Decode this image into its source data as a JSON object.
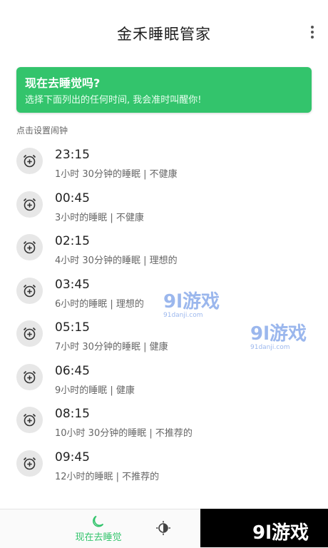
{
  "app": {
    "title": "金禾睡眠管家"
  },
  "banner": {
    "title": "现在去睡觉吗?",
    "subtitle": "选择下面列出的任何时间, 我会准时叫醒你!"
  },
  "section_label": "点击设置闹钟",
  "alarms": [
    {
      "time": "23:15",
      "desc": "1小时 30分钟的睡眠 | 不健康"
    },
    {
      "time": "00:45",
      "desc": "3小时的睡眠 | 不健康"
    },
    {
      "time": "02:15",
      "desc": "4小时 30分钟的睡眠 | 理想的"
    },
    {
      "time": "03:45",
      "desc": "6小时的睡眠 | 理想的"
    },
    {
      "time": "05:15",
      "desc": "7小时 30分钟的睡眠 | 健康"
    },
    {
      "time": "06:45",
      "desc": "9小时的睡眠 | 健康"
    },
    {
      "time": "08:15",
      "desc": "10小时 30分钟的睡眠 | 不推荐的"
    },
    {
      "time": "09:45",
      "desc": "12小时的睡眠 | 不推荐的"
    }
  ],
  "watermarks": [
    {
      "logo": "9l游戏",
      "url": "91danji.com"
    },
    {
      "logo": "9l游戏",
      "url": "91danji.com"
    }
  ],
  "bottom_nav": {
    "active_label": "现在去睡觉",
    "active_icon": "moon-icon",
    "second_icon": "sun-moon-icon"
  },
  "brand": {
    "text": "9l游戏"
  },
  "colors": {
    "accent": "#33c46c",
    "icon_bg": "#e7e7e7"
  }
}
